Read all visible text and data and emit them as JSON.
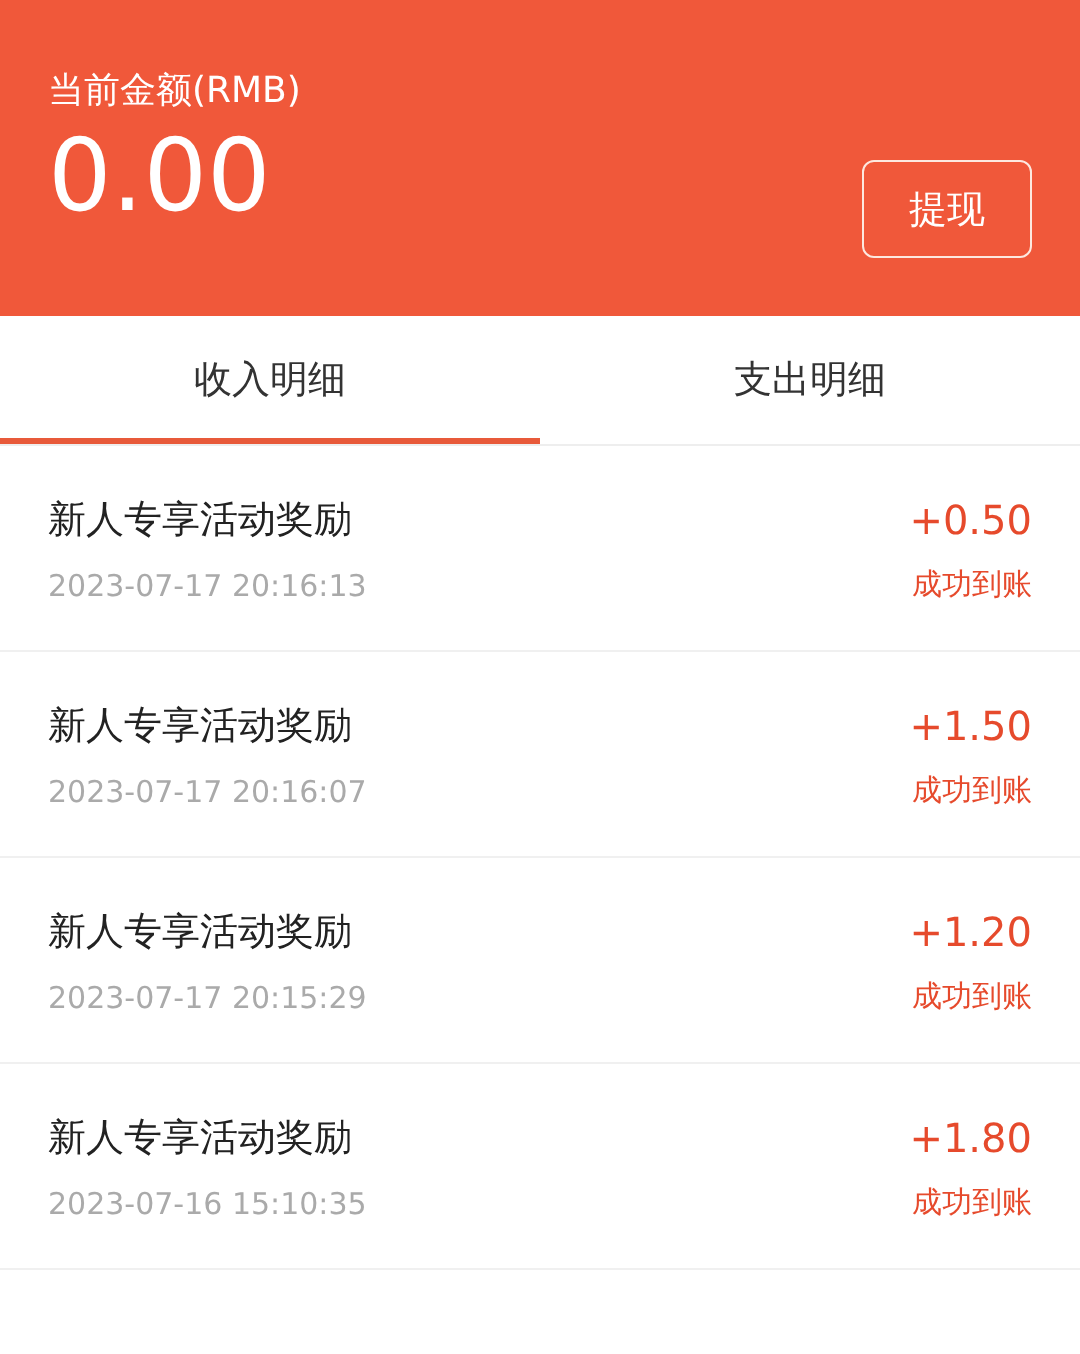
{
  "balance": {
    "label": "当前金额(RMB)",
    "amount": "0.00",
    "button": "提现"
  },
  "tabs": [
    {
      "label": "收入明细",
      "selected": true
    },
    {
      "label": "支出明细",
      "selected": false
    }
  ],
  "records": [
    {
      "title": "新人专享活动奖励",
      "time": "2023-07-17 20:16:13",
      "amount": "+0.50",
      "status": "成功到账"
    },
    {
      "title": "新人专享活动奖励",
      "time": "2023-07-17 20:16:07",
      "amount": "+1.50",
      "status": "成功到账"
    },
    {
      "title": "新人专享活动奖励",
      "time": "2023-07-17 20:15:29",
      "amount": "+1.20",
      "status": "成功到账"
    },
    {
      "title": "新人专享活动奖励",
      "time": "2023-07-16 15:10:35",
      "amount": "+1.80",
      "status": "成功到账"
    }
  ]
}
